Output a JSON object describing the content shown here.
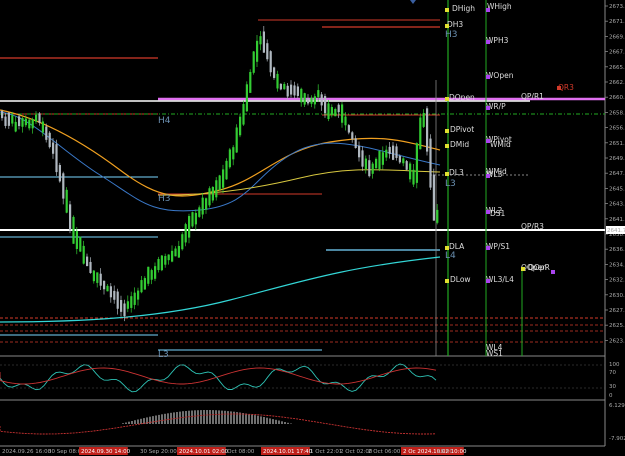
{
  "price_axis": {
    "ticks": [
      "2673.140",
      "2671.415",
      "2669.335",
      "2667.370",
      "2665.030",
      "2662.880",
      "2660.670",
      "2658.460",
      "2656.200",
      "2651.965",
      "2649.750",
      "2647.540",
      "2645.400",
      "2643.096",
      "2641.795",
      "2638.835",
      "2636.800",
      "2634.485",
      "2632.315",
      "2630.125",
      "2627.900",
      "2625.775",
      "2623.625"
    ],
    "current_price": "2641.795"
  },
  "osc1_axis": {
    "ticks": [
      "100",
      "70",
      "30",
      "0"
    ]
  },
  "osc2_axis": {
    "ticks": [
      "6.1295",
      "-7.902"
    ]
  },
  "time_axis": {
    "labels": [
      {
        "text": "2024.09.26 16:00",
        "hl": false
      },
      {
        "text": "30 Sep 08:00",
        "hl": false
      },
      {
        "text": "2024.09.30 14:00",
        "hl": true
      },
      {
        "text": "30 Sep 20:00",
        "hl": false
      },
      {
        "text": "2024.10.01 02:00",
        "hl": true
      },
      {
        "text": "1 Oct 08:00",
        "hl": false
      },
      {
        "text": "2024.10.01 17:40",
        "hl": true
      },
      {
        "text": "1 Oct 22:01",
        "hl": false
      },
      {
        "text": "2 Oct 02:00",
        "hl": false
      },
      {
        "text": "2 Oct 06:00",
        "hl": false
      },
      {
        "text": "2 Oc 2024.10.02 10:00",
        "hl": true
      },
      {
        "text": "18:00",
        "hl": false
      }
    ]
  },
  "levels": {
    "dhigh": "DHigh",
    "whigh": "WHigh",
    "dh3": "DH3",
    "h3_top": "H3",
    "wph3": "WPH3",
    "wopen": "WOpen",
    "qr3": "QR3",
    "qpr1": "QP/R1",
    "dopen": "DOpen",
    "wr_p": "WR/P",
    "h4": "H4",
    "dpivot": "DPivot",
    "wpivot": "WPivot",
    "dmid": "DMid",
    "wmid": "WMid",
    "dl3": "DL3",
    "wl3": "WL3",
    "l3": "L3",
    "h3": "H3",
    "wl2": "WL2",
    "ds1": "DS1",
    "qp_r3": "QP/R3",
    "dla": "DLA",
    "wps1": "WP/S1",
    "l4": "L4",
    "qopen": "QOpen",
    "qopr": "QOpR",
    "dlow": "DLow",
    "wl3l4": "WL3/L4",
    "l3_bottom": "L3",
    "wl4": "WL4",
    "ws1": "WS1"
  },
  "colors": {
    "background": "#000000",
    "bull_candle": "#33cc33",
    "bear_candle": "#b0b8c0",
    "ma_orange": "#f0a020",
    "ma_blue": "#3a78c8",
    "ma_cyan": "#33d6d6",
    "ma_yellow": "#d8c840",
    "level_red": "#d23a2a",
    "level_magenta": "#e070f0",
    "level_white": "#ffffff",
    "level_green": "#22aa22",
    "level_lightblue": "#7ad6ff"
  },
  "icons": [
    "settings-panel-icon",
    "scroll-marker-icon"
  ]
}
